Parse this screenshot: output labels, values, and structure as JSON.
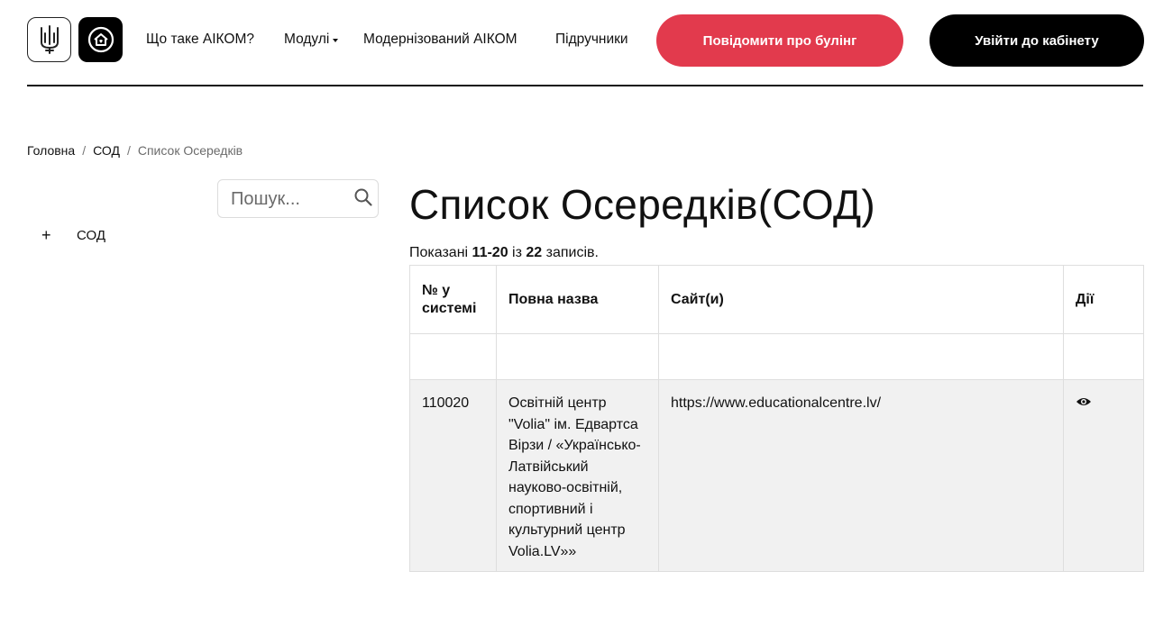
{
  "header": {
    "nav": [
      {
        "label": "Що таке АІКОМ?"
      },
      {
        "label": "Модулі",
        "has_dropdown": true
      },
      {
        "label": "Модернізований АІКОМ"
      },
      {
        "label": "Підручники"
      }
    ],
    "bullying_button": "Повідомити про булінг",
    "login_button": "Увійти до кабінету",
    "colors": {
      "bullying": "#e23a4d",
      "login": "#000000"
    }
  },
  "breadcrumb": {
    "items": [
      "Головна",
      "СОД"
    ],
    "current": "Список Осередків",
    "separator": "/"
  },
  "sidebar": {
    "search_placeholder": "Пошук...",
    "tree": [
      {
        "expander": "+",
        "label": "СОД"
      }
    ]
  },
  "main": {
    "title": "Список Осередків(СОД)",
    "summary": {
      "prefix": "Показані ",
      "range": "11-20",
      "middle": " із ",
      "total": "22",
      "suffix": " записів."
    },
    "table": {
      "headers": [
        "№ у системі",
        "Повна назва",
        "Сайт(и)",
        "Дії"
      ],
      "rows": [
        {
          "id": "110020",
          "name": "Освітній центр \"Volia\" ім. Едвартса Вірзи / «Українсько-Латвійський науково-освітній, спортивний і культурний центр Volia.LV»»",
          "site": "https://www.educationalcentre.lv/",
          "action_icon": "eye-icon"
        }
      ]
    }
  }
}
